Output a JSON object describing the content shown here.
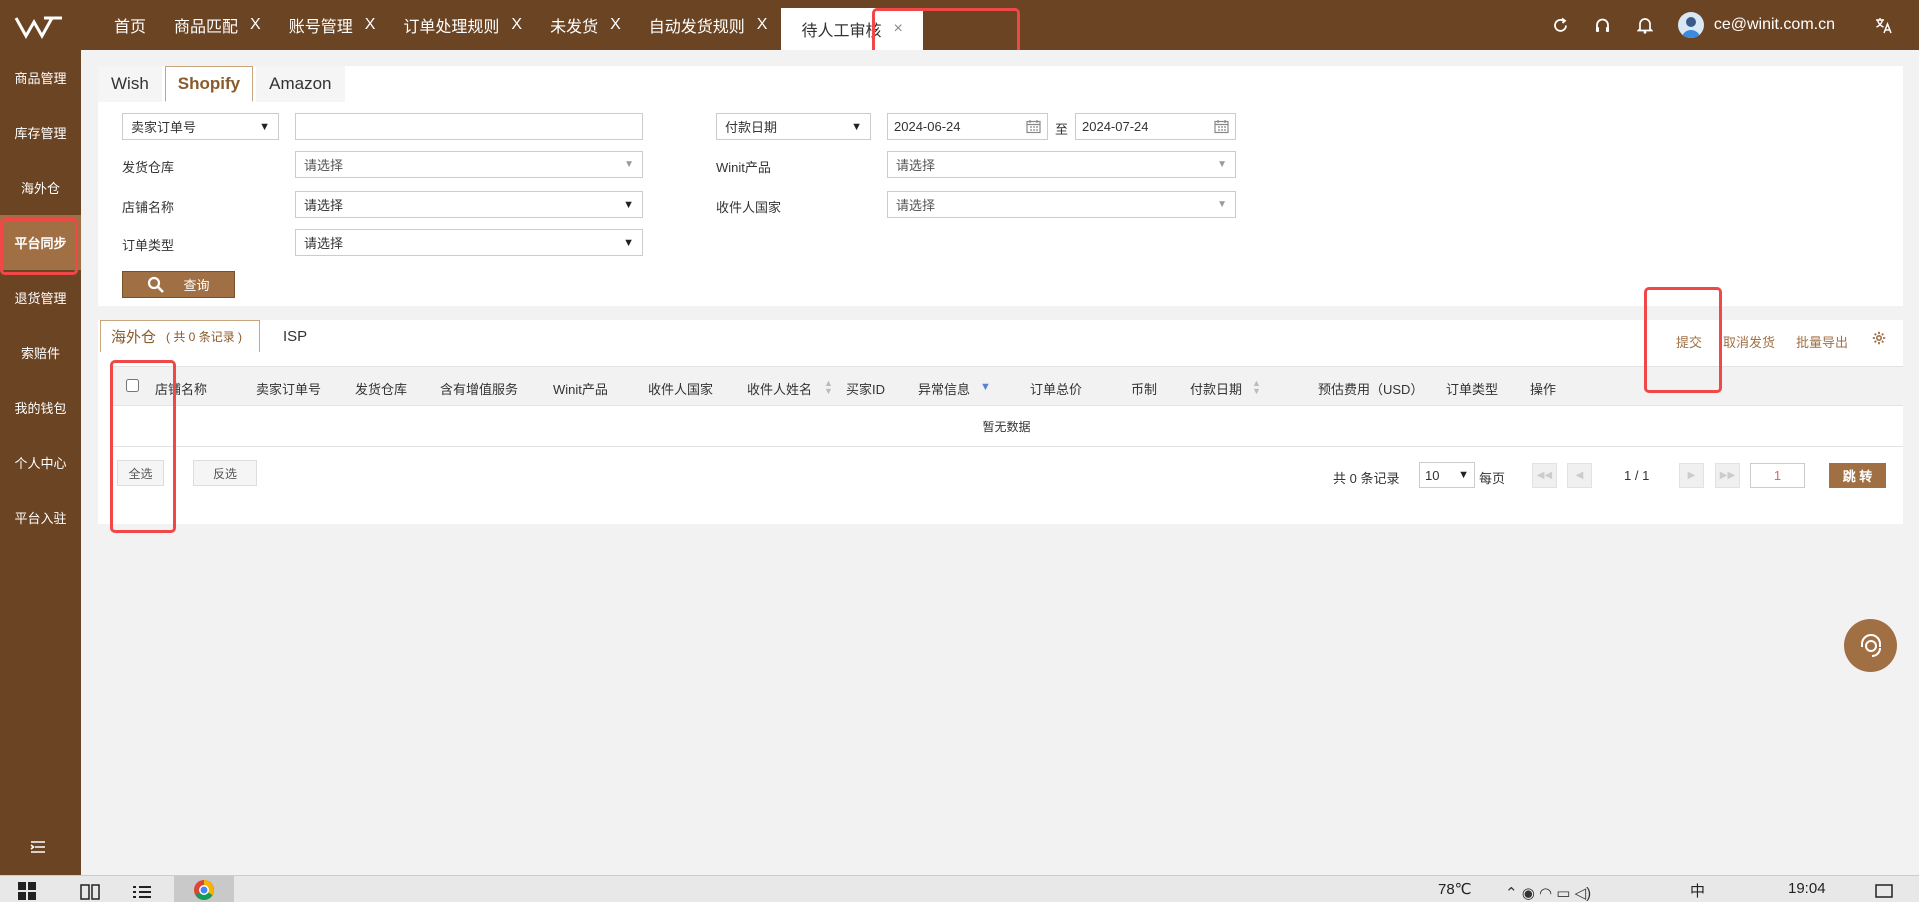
{
  "header": {
    "tabs": [
      {
        "label": "首页",
        "closable": false
      },
      {
        "label": "商品匹配",
        "closable": true
      },
      {
        "label": "账号管理",
        "closable": true
      },
      {
        "label": "订单处理规则",
        "closable": true
      },
      {
        "label": "未发货",
        "closable": true
      },
      {
        "label": "自动发货规则",
        "closable": true
      },
      {
        "label": "待人工审核",
        "closable": true,
        "active": true
      }
    ],
    "close_glyph": "X",
    "user_email": "ce@winit.com.cn"
  },
  "sidebar": {
    "items": [
      {
        "label": "商品管理"
      },
      {
        "label": "库存管理"
      },
      {
        "label": "海外仓"
      },
      {
        "label": "平台同步",
        "active": true
      },
      {
        "label": "退货管理"
      },
      {
        "label": "索赔件"
      },
      {
        "label": "我的钱包"
      },
      {
        "label": "个人中心"
      },
      {
        "label": "平台入驻"
      }
    ]
  },
  "platform_tabs": [
    "Wish",
    "Shopify",
    "Amazon"
  ],
  "active_platform": "Shopify",
  "filters": {
    "order_type_select": "卖家订单号",
    "order_no_value": "",
    "warehouse_label": "发货仓库",
    "warehouse_value": "请选择",
    "shop_label": "店铺名称",
    "shop_value": "请选择",
    "order_kind_label": "订单类型",
    "order_kind_value": "请选择",
    "date_type_select": "付款日期",
    "date_from": "2024-06-24",
    "date_sep": "至",
    "date_to": "2024-07-24",
    "product_label": "Winit产品",
    "product_value": "请选择",
    "country_label": "收件人国家",
    "country_value": "请选择",
    "query_label": "查询"
  },
  "result": {
    "tabs": {
      "overseas": "海外仓",
      "overseas_count": "( 共 0 条记录 )",
      "isp": "ISP"
    },
    "actions": {
      "submit": "提交",
      "cancel": "取消发货",
      "export": "批量导出"
    },
    "columns": [
      "店铺名称",
      "卖家订单号",
      "发货仓库",
      "含有增值服务",
      "Winit产品",
      "收件人国家",
      "收件人姓名",
      "买家ID",
      "异常信息",
      "订单总价",
      "币制",
      "付款日期",
      "预估费用（USD）",
      "订单类型",
      "操作"
    ],
    "empty_text": "暂无数据",
    "select_all": "全选",
    "invert": "反选",
    "total_text": "共 0 条记录",
    "page_size": "10",
    "per_page": "每页",
    "page_indicator": "1 / 1",
    "jump_value": "1",
    "jump_label": "跳 转"
  },
  "taskbar": {
    "temperature": "78℃",
    "time": "19:04",
    "ime": "中"
  },
  "colors": {
    "brand_brown": "#6b4423",
    "accent": "#a07044",
    "highlight": "#f04848"
  }
}
